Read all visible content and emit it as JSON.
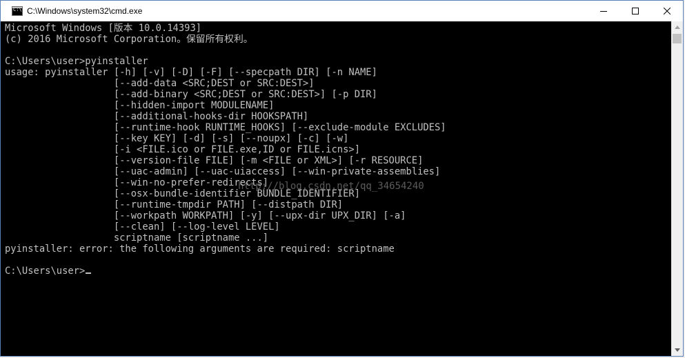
{
  "window": {
    "title": "C:\\Windows\\system32\\cmd.exe"
  },
  "console": {
    "lines": [
      "Microsoft Windows [版本 10.0.14393]",
      "(c) 2016 Microsoft Corporation。保留所有权利。",
      "",
      "C:\\Users\\user>pyinstaller",
      "usage: pyinstaller [-h] [-v] [-D] [-F] [--specpath DIR] [-n NAME]",
      "                   [--add-data <SRC;DEST or SRC:DEST>]",
      "                   [--add-binary <SRC;DEST or SRC:DEST>] [-p DIR]",
      "                   [--hidden-import MODULENAME]",
      "                   [--additional-hooks-dir HOOKSPATH]",
      "                   [--runtime-hook RUNTIME_HOOKS] [--exclude-module EXCLUDES]",
      "                   [--key KEY] [-d] [-s] [--noupx] [-c] [-w]",
      "                   [-i <FILE.ico or FILE.exe,ID or FILE.icns>]",
      "                   [--version-file FILE] [-m <FILE or XML>] [-r RESOURCE]",
      "                   [--uac-admin] [--uac-uiaccess] [--win-private-assemblies]",
      "                   [--win-no-prefer-redirects]",
      "                   [--osx-bundle-identifier BUNDLE_IDENTIFIER]",
      "                   [--runtime-tmpdir PATH] [--distpath DIR]",
      "                   [--workpath WORKPATH] [-y] [--upx-dir UPX_DIR] [-a]",
      "                   [--clean] [--log-level LEVEL]",
      "                   scriptname [scriptname ...]",
      "pyinstaller: error: the following arguments are required: scriptname",
      "",
      "C:\\Users\\user>"
    ],
    "watermark": "http://blog.csdn.net/qq_34654240"
  },
  "colors": {
    "console_background": "#000000",
    "console_text": "#c0c0c0",
    "titlebar_background": "#ffffff",
    "window_border": "#5a7fb5"
  },
  "icons": {
    "app": "cmd-icon",
    "minimize": "minimize-icon",
    "maximize": "maximize-icon",
    "close": "close-icon",
    "scroll_up": "scroll-up-arrow-icon",
    "scroll_down": "scroll-down-arrow-icon"
  }
}
